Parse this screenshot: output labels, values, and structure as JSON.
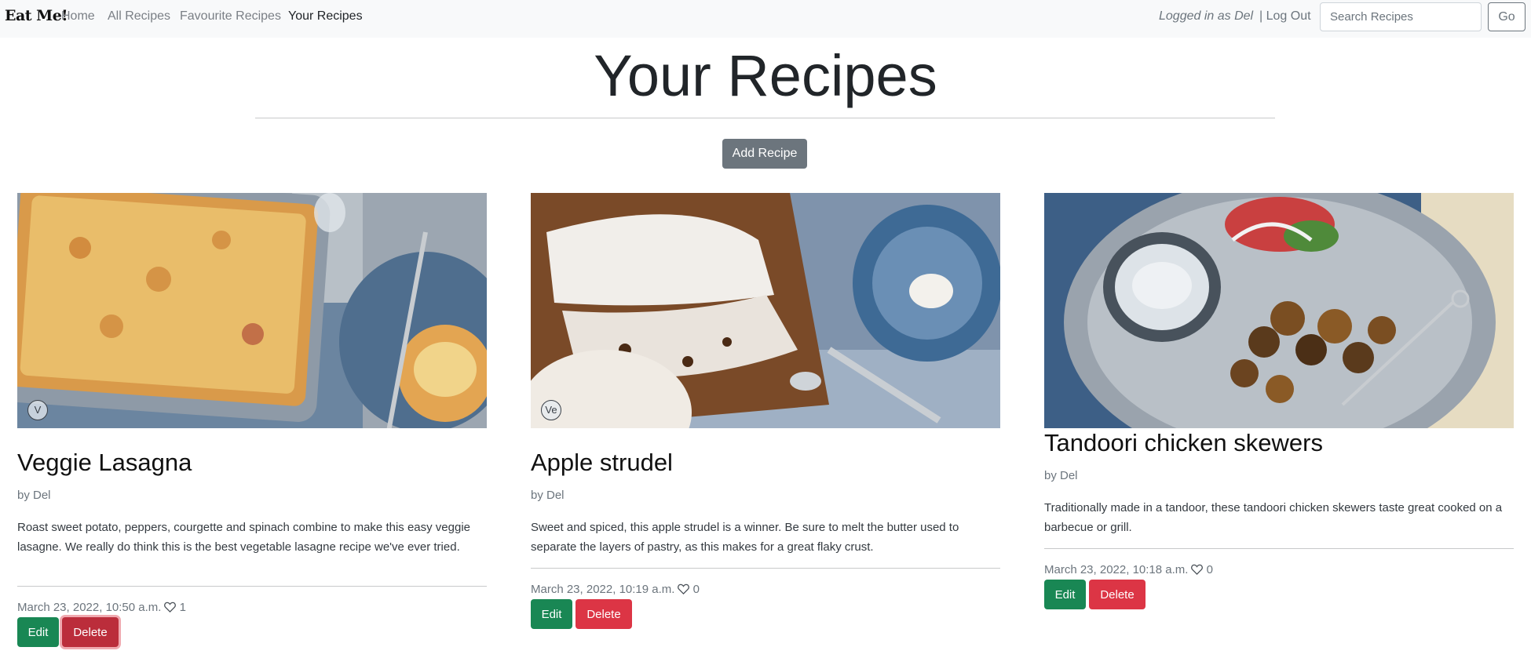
{
  "nav": {
    "brand": "Eat Me!",
    "links": [
      "Home",
      "All Recipes",
      "Favourite Recipes",
      "Your Recipes"
    ],
    "active": "Your Recipes",
    "logged_in": "Logged in as Del",
    "logout": "| Log Out",
    "search_placeholder": "Search Recipes",
    "go_label": "Go"
  },
  "page": {
    "title": "Your Recipes",
    "add_label": "Add Recipe"
  },
  "recipes": [
    {
      "title": "Veggie Lasagna",
      "author": "by Del",
      "description": "Roast sweet potato, peppers, courgette and spinach combine to make this easy veggie lasagne. We really do think this is the best vegetable lasagne recipe we've ever tried.",
      "date": "March 23, 2022, 10:50 a.m.",
      "likes": "1",
      "badge": "V",
      "edit_label": "Edit",
      "delete_label": "Delete"
    },
    {
      "title": "Apple strudel",
      "author": "by Del",
      "description": "Sweet and spiced, this apple strudel is a winner. Be sure to melt the butter used to separate the layers of pastry, as this makes for a great flaky crust.",
      "date": "March 23, 2022, 10:19 a.m.",
      "likes": "0",
      "badge": "Ve",
      "edit_label": "Edit",
      "delete_label": "Delete"
    },
    {
      "title": "Tandoori chicken skewers",
      "author": "by Del",
      "description": "Traditionally made in a tandoor, these tandoori chicken skewers taste great cooked on a barbecue or grill.",
      "date": "March 23, 2022, 10:18 a.m.",
      "likes": "0",
      "edit_label": "Edit",
      "delete_label": "Delete"
    }
  ],
  "colors": {
    "navbar_bg": "#f8f9fa",
    "secondary": "#6c757d",
    "success": "#198754",
    "danger": "#dc3545"
  }
}
